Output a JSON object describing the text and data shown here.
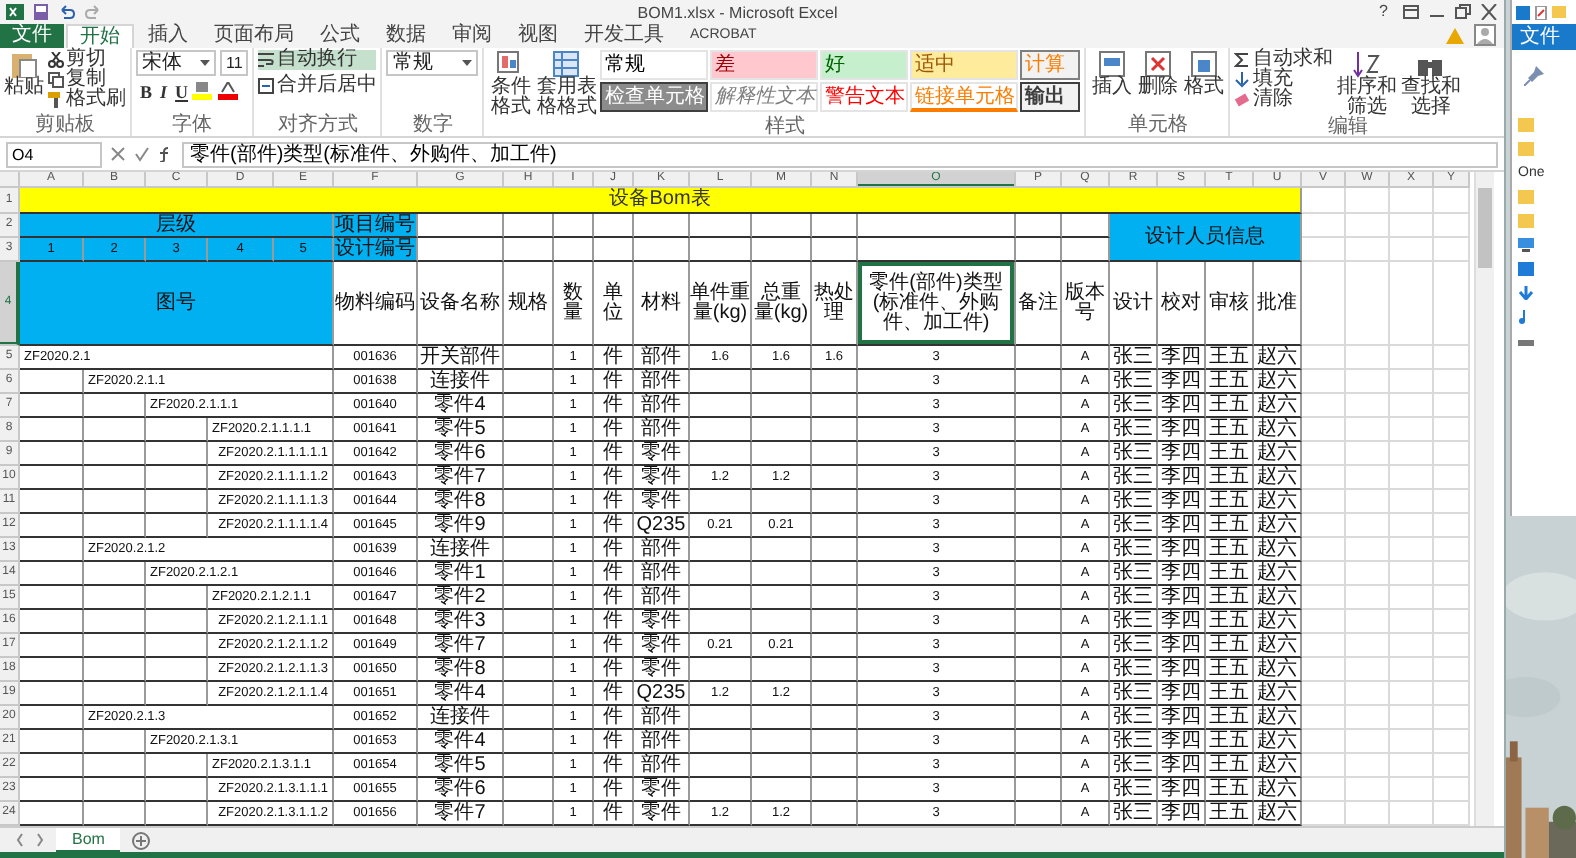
{
  "title_bar": {
    "title": "BOM1.xlsx - Microsoft Excel",
    "help": "?"
  },
  "ribbon_tabs": [
    {
      "label": "文件",
      "kind": "file",
      "selected": false
    },
    {
      "label": "开始",
      "kind": "tab",
      "selected": true
    },
    {
      "label": "插入",
      "kind": "tab",
      "selected": false
    },
    {
      "label": "页面布局",
      "kind": "tab",
      "selected": false
    },
    {
      "label": "公式",
      "kind": "tab",
      "selected": false
    },
    {
      "label": "数据",
      "kind": "tab",
      "selected": false
    },
    {
      "label": "审阅",
      "kind": "tab",
      "selected": false
    },
    {
      "label": "视图",
      "kind": "tab",
      "selected": false
    },
    {
      "label": "开发工具",
      "kind": "tab",
      "selected": false
    },
    {
      "label": "ACROBAT",
      "kind": "tab",
      "selected": false
    }
  ],
  "ribbon": {
    "clipboard": {
      "paste": "粘贴",
      "items": [
        "剪切",
        "复制",
        "格式刷"
      ],
      "label": "剪贴板"
    },
    "font": {
      "name": "宋体",
      "size": "11",
      "buttons": [
        "B",
        "I",
        "U"
      ],
      "label": "字体"
    },
    "alignment": {
      "wrap": "自动换行",
      "merge": "合并后居中",
      "label": "对齐方式"
    },
    "number": {
      "format": "常规",
      "label": "数字"
    },
    "styles": {
      "conditional": "条件格式",
      "table": "套用表格格式",
      "label": "样式",
      "gallery": [
        {
          "label": "常规",
          "kind": "normal"
        },
        {
          "label": "差",
          "kind": "bad"
        },
        {
          "label": "好",
          "kind": "good"
        },
        {
          "label": "适中",
          "kind": "neutral"
        },
        {
          "label": "计算",
          "kind": "calc"
        },
        {
          "label": "检查单元格",
          "kind": "check"
        },
        {
          "label": "解释性文本",
          "kind": "explanatory"
        },
        {
          "label": "警告文本",
          "kind": "warning"
        },
        {
          "label": "链接单元格",
          "kind": "linked"
        },
        {
          "label": "输出",
          "kind": "output"
        }
      ]
    },
    "cells": {
      "items": [
        "插入",
        "删除",
        "格式"
      ],
      "label": "单元格"
    },
    "editing": {
      "items": [
        "自动求和",
        "填充",
        "清除"
      ],
      "sort": "排序和筛选",
      "find": "查找和选择",
      "label": "编辑"
    }
  },
  "formula_bar": {
    "name_box": "O4",
    "content": "零件(部件)类型(标准件、外购件、加工件)"
  },
  "sheet": {
    "columns": [
      {
        "label": "A",
        "selected": false
      },
      {
        "label": "B",
        "selected": false
      },
      {
        "label": "C",
        "selected": false
      },
      {
        "label": "D",
        "selected": false
      },
      {
        "label": "E",
        "selected": false
      },
      {
        "label": "F",
        "selected": false
      },
      {
        "label": "G",
        "selected": false
      },
      {
        "label": "H",
        "selected": false
      },
      {
        "label": "I",
        "selected": false
      },
      {
        "label": "J",
        "selected": false
      },
      {
        "label": "K",
        "selected": false
      },
      {
        "label": "L",
        "selected": false
      },
      {
        "label": "M",
        "selected": false
      },
      {
        "label": "N",
        "selected": false
      },
      {
        "label": "O",
        "selected": true
      },
      {
        "label": "P",
        "selected": false
      },
      {
        "label": "Q",
        "selected": false
      },
      {
        "label": "R",
        "selected": false
      },
      {
        "label": "S",
        "selected": false
      },
      {
        "label": "T",
        "selected": false
      },
      {
        "label": "U",
        "selected": false
      },
      {
        "label": "V",
        "selected": false
      },
      {
        "label": "W",
        "selected": false
      },
      {
        "label": "X",
        "selected": false
      },
      {
        "label": "Y",
        "selected": false
      }
    ],
    "header_row_numbers": [
      {
        "label": "1",
        "selected": false
      },
      {
        "label": "2",
        "selected": false
      },
      {
        "label": "3",
        "selected": false
      },
      {
        "label": "4",
        "selected": true
      }
    ],
    "title": "设备Bom表",
    "level_header": "层级",
    "levels": [
      "1",
      "2",
      "3",
      "4",
      "5"
    ],
    "drawing_header": "图号",
    "project_no": "项目编号",
    "design_no": "设计编号",
    "designer_header": "设计人员信息",
    "column_headers": [
      {
        "text": "物料编码",
        "selected": false
      },
      {
        "text": "设备名称",
        "selected": false
      },
      {
        "text": "规格",
        "selected": false
      },
      {
        "text": "数量",
        "selected": false
      },
      {
        "text": "单位",
        "selected": false
      },
      {
        "text": "材料",
        "selected": false
      },
      {
        "text": "单件重量(kg)",
        "selected": false
      },
      {
        "text": "总重量(kg)",
        "selected": false
      },
      {
        "text": "热处理",
        "selected": false
      },
      {
        "text": "零件(部件)类型(标准件、外购件、加工件)",
        "selected": true
      },
      {
        "text": "备注",
        "selected": false
      },
      {
        "text": "版本号",
        "selected": false
      },
      {
        "text": "设计",
        "selected": false
      },
      {
        "text": "校对",
        "selected": false
      },
      {
        "text": "审核",
        "selected": false
      },
      {
        "text": "批准",
        "selected": false
      }
    ],
    "rows": [
      {
        "row": "5",
        "code": "ZF2020.2.1",
        "material": "001636",
        "name": "开关部件",
        "qty": "1",
        "unit": "件",
        "kind": "部件",
        "unit_weight": "1.6",
        "total_weight": "1.6",
        "heat": "1.6",
        "part_type": "3",
        "version": "A",
        "designer": "张三",
        "checker": "李四",
        "reviewer": "王五",
        "approver": "赵六",
        "children": [
          {
            "row": "6",
            "code": "ZF2020.2.1.1",
            "material": "001638",
            "name": "连接件",
            "qty": "1",
            "unit": "件",
            "kind": "部件",
            "part_type": "3",
            "version": "A",
            "designer": "张三",
            "checker": "李四",
            "reviewer": "王五",
            "approver": "赵六",
            "children": [
              {
                "row": "7",
                "code": "ZF2020.2.1.1.1",
                "material": "001640",
                "name": "零件4",
                "qty": "1",
                "unit": "件",
                "kind": "部件",
                "part_type": "3",
                "version": "A",
                "designer": "张三",
                "checker": "李四",
                "reviewer": "王五",
                "approver": "赵六",
                "children": [
                  {
                    "row": "8",
                    "code": "ZF2020.2.1.1.1.1",
                    "material": "001641",
                    "name": "零件5",
                    "qty": "1",
                    "unit": "件",
                    "kind": "部件",
                    "part_type": "3",
                    "version": "A",
                    "designer": "张三",
                    "checker": "李四",
                    "reviewer": "王五",
                    "approver": "赵六",
                    "children": [
                      {
                        "row": "9",
                        "code": "ZF2020.2.1.1.1.1.1",
                        "material": "001642",
                        "name": "零件6",
                        "qty": "1",
                        "unit": "件",
                        "kind": "零件",
                        "part_type": "3",
                        "version": "A",
                        "designer": "张三",
                        "checker": "李四",
                        "reviewer": "王五",
                        "approver": "赵六"
                      },
                      {
                        "row": "10",
                        "code": "ZF2020.2.1.1.1.1.2",
                        "material": "001643",
                        "name": "零件7",
                        "qty": "1",
                        "unit": "件",
                        "kind": "零件",
                        "unit_weight": "1.2",
                        "total_weight": "1.2",
                        "part_type": "3",
                        "version": "A",
                        "designer": "张三",
                        "checker": "李四",
                        "reviewer": "王五",
                        "approver": "赵六"
                      },
                      {
                        "row": "11",
                        "code": "ZF2020.2.1.1.1.1.3",
                        "material": "001644",
                        "name": "零件8",
                        "qty": "1",
                        "unit": "件",
                        "kind": "零件",
                        "part_type": "3",
                        "version": "A",
                        "designer": "张三",
                        "checker": "李四",
                        "reviewer": "王五",
                        "approver": "赵六"
                      },
                      {
                        "row": "12",
                        "code": "ZF2020.2.1.1.1.1.4",
                        "material": "001645",
                        "name": "零件9",
                        "qty": "1",
                        "unit": "件",
                        "kind": "Q235",
                        "unit_weight": "0.21",
                        "total_weight": "0.21",
                        "part_type": "3",
                        "version": "A",
                        "designer": "张三",
                        "checker": "李四",
                        "reviewer": "王五",
                        "approver": "赵六"
                      }
                    ]
                  }
                ]
              }
            ]
          },
          {
            "row": "13",
            "code": "ZF2020.2.1.2",
            "material": "001639",
            "name": "连接件",
            "qty": "1",
            "unit": "件",
            "kind": "部件",
            "part_type": "3",
            "version": "A",
            "designer": "张三",
            "checker": "李四",
            "reviewer": "王五",
            "approver": "赵六",
            "children": [
              {
                "row": "14",
                "code": "ZF2020.2.1.2.1",
                "material": "001646",
                "name": "零件1",
                "qty": "1",
                "unit": "件",
                "kind": "部件",
                "part_type": "3",
                "version": "A",
                "designer": "张三",
                "checker": "李四",
                "reviewer": "王五",
                "approver": "赵六",
                "children": [
                  {
                    "row": "15",
                    "code": "ZF2020.2.1.2.1.1",
                    "material": "001647",
                    "name": "零件2",
                    "qty": "1",
                    "unit": "件",
                    "kind": "部件",
                    "part_type": "3",
                    "version": "A",
                    "designer": "张三",
                    "checker": "李四",
                    "reviewer": "王五",
                    "approver": "赵六",
                    "children": [
                      {
                        "row": "16",
                        "code": "ZF2020.2.1.2.1.1.1",
                        "material": "001648",
                        "name": "零件3",
                        "qty": "1",
                        "unit": "件",
                        "kind": "零件",
                        "part_type": "3",
                        "version": "A",
                        "designer": "张三",
                        "checker": "李四",
                        "reviewer": "王五",
                        "approver": "赵六"
                      },
                      {
                        "row": "17",
                        "code": "ZF2020.2.1.2.1.1.2",
                        "material": "001649",
                        "name": "零件7",
                        "qty": "1",
                        "unit": "件",
                        "kind": "零件",
                        "unit_weight": "0.21",
                        "total_weight": "0.21",
                        "part_type": "3",
                        "version": "A",
                        "designer": "张三",
                        "checker": "李四",
                        "reviewer": "王五",
                        "approver": "赵六"
                      },
                      {
                        "row": "18",
                        "code": "ZF2020.2.1.2.1.1.3",
                        "material": "001650",
                        "name": "零件8",
                        "qty": "1",
                        "unit": "件",
                        "kind": "零件",
                        "part_type": "3",
                        "version": "A",
                        "designer": "张三",
                        "checker": "李四",
                        "reviewer": "王五",
                        "approver": "赵六"
                      },
                      {
                        "row": "19",
                        "code": "ZF2020.2.1.2.1.1.4",
                        "material": "001651",
                        "name": "零件4",
                        "qty": "1",
                        "unit": "件",
                        "kind": "Q235",
                        "unit_weight": "1.2",
                        "total_weight": "1.2",
                        "part_type": "3",
                        "version": "A",
                        "designer": "张三",
                        "checker": "李四",
                        "reviewer": "王五",
                        "approver": "赵六"
                      }
                    ]
                  }
                ]
              }
            ]
          },
          {
            "row": "20",
            "code": "ZF2020.2.1.3",
            "material": "001652",
            "name": "连接件",
            "qty": "1",
            "unit": "件",
            "kind": "部件",
            "part_type": "3",
            "version": "A",
            "designer": "张三",
            "checker": "李四",
            "reviewer": "王五",
            "approver": "赵六",
            "children": [
              {
                "row": "21",
                "code": "ZF2020.2.1.3.1",
                "material": "001653",
                "name": "零件4",
                "qty": "1",
                "unit": "件",
                "kind": "部件",
                "part_type": "3",
                "version": "A",
                "designer": "张三",
                "checker": "李四",
                "reviewer": "王五",
                "approver": "赵六",
                "children": [
                  {
                    "row": "22",
                    "code": "ZF2020.2.1.3.1.1",
                    "material": "001654",
                    "name": "零件5",
                    "qty": "1",
                    "unit": "件",
                    "kind": "部件",
                    "part_type": "3",
                    "version": "A",
                    "designer": "张三",
                    "checker": "李四",
                    "reviewer": "王五",
                    "approver": "赵六",
                    "children": [
                      {
                        "row": "23",
                        "code": "ZF2020.2.1.3.1.1.1",
                        "material": "001655",
                        "name": "零件6",
                        "qty": "1",
                        "unit": "件",
                        "kind": "零件",
                        "part_type": "3",
                        "version": "A",
                        "designer": "张三",
                        "checker": "李四",
                        "reviewer": "王五",
                        "approver": "赵六"
                      },
                      {
                        "row": "24",
                        "code": "ZF2020.2.1.3.1.1.2",
                        "material": "001656",
                        "name": "零件7",
                        "qty": "1",
                        "unit": "件",
                        "kind": "零件",
                        "unit_weight": "1.2",
                        "total_weight": "1.2",
                        "part_type": "3",
                        "version": "A",
                        "designer": "张三",
                        "checker": "李四",
                        "reviewer": "王五",
                        "approver": "赵六"
                      }
                    ]
                  }
                ]
              }
            ]
          }
        ]
      }
    ]
  },
  "sheet_tabs": [
    {
      "label": "Bom",
      "selected": true
    }
  ],
  "explorer": {
    "tab": "文件",
    "nav_item": "One"
  }
}
